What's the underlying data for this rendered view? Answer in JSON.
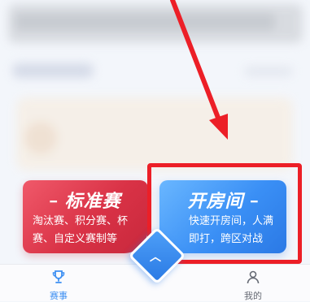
{
  "standard_card": {
    "title": "标准赛",
    "description": "淘汰赛、积分赛、杯赛、自定义赛制等"
  },
  "room_card": {
    "title": "开房间",
    "description": "快速开房间，人满即打，跨区对战"
  },
  "bottom_nav": {
    "events_label": "赛事",
    "mine_label": "我的",
    "center_icon": "chevron-up-icon"
  },
  "colors": {
    "standard_card": "#d93246",
    "room_card": "#3a8ff5",
    "highlight": "#ec1f27",
    "nav_active": "#3d8ff2"
  }
}
